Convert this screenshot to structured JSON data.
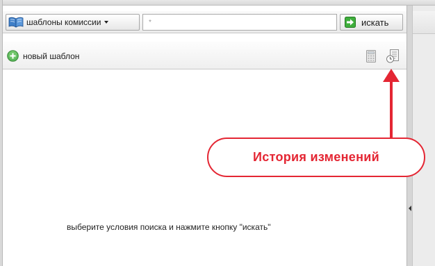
{
  "toolbar": {
    "type_select_label": "шаблоны комиссии",
    "search_value": "*",
    "search_button_label": "искать"
  },
  "actions": {
    "new_template_label": "новый шаблон"
  },
  "main": {
    "empty_message": "выберите условия поиска и нажмите кнопку \"искать\""
  },
  "annotation": {
    "callout_text": "История изменений",
    "color": "#e42633"
  },
  "icons": {
    "type_select": "book-icon",
    "search_button": "arrow-right-icon",
    "new_template": "plus-circle-icon",
    "calculator": "calculator-icon",
    "history": "history-icon"
  }
}
